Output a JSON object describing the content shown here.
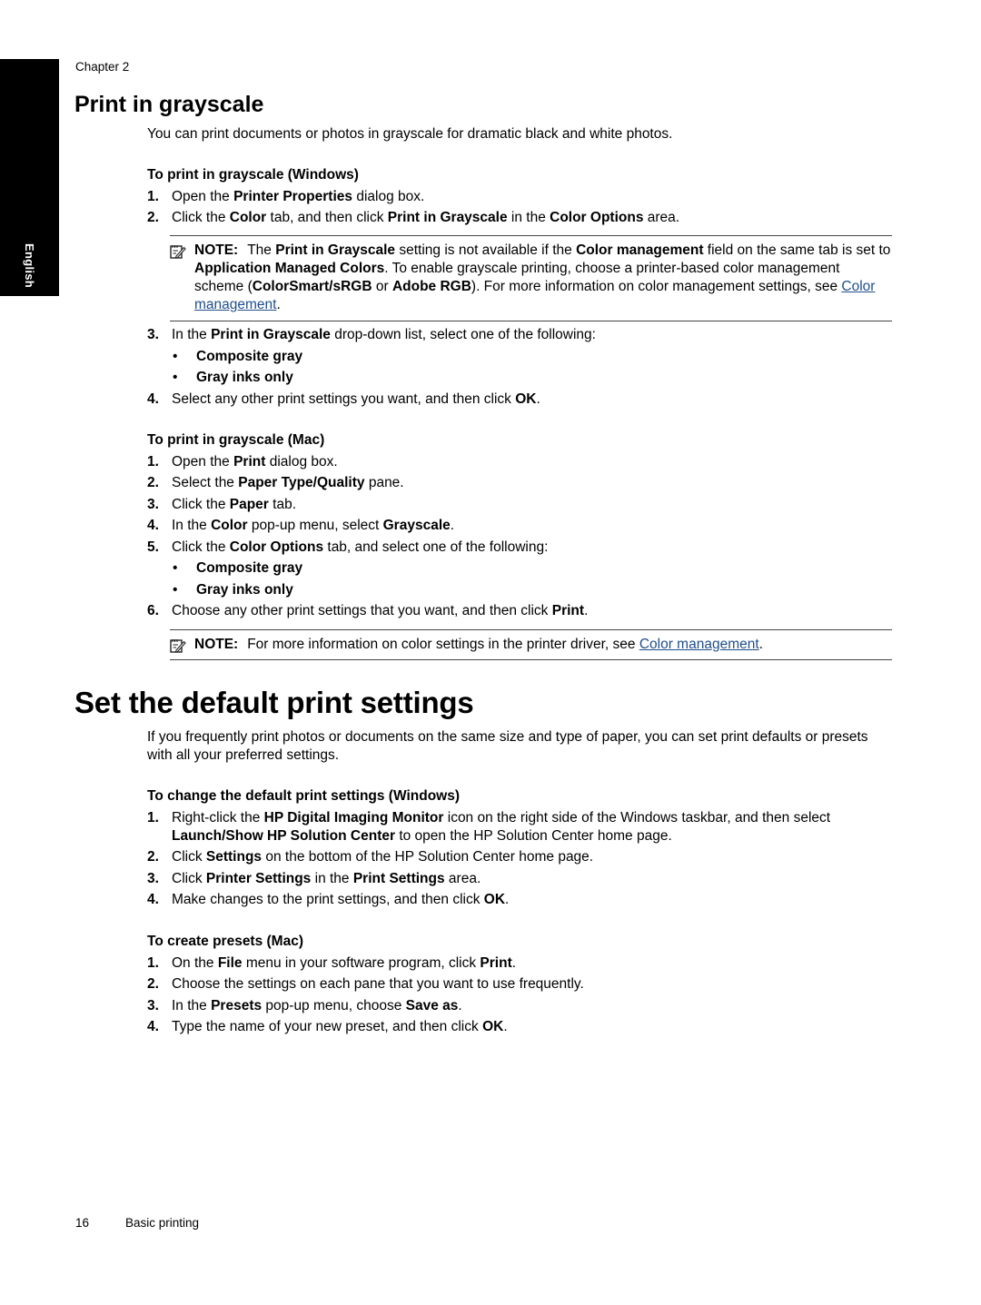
{
  "side_tab": {
    "label": "English"
  },
  "chapter": "Chapter 2",
  "colors": {
    "link": "#1f4e8c",
    "side_tab_bg": "#000000"
  },
  "section1": {
    "title": "Print in grayscale",
    "intro": "You can print documents or photos in grayscale for dramatic black and white photos.",
    "windows": {
      "heading": "To print in grayscale (Windows)",
      "steps_a": [
        {
          "num": "1.",
          "parts": [
            {
              "t": "Open the "
            },
            {
              "t": "Printer Properties",
              "b": true
            },
            {
              "t": " dialog box."
            }
          ]
        },
        {
          "num": "2.",
          "parts": [
            {
              "t": "Click the "
            },
            {
              "t": "Color",
              "b": true
            },
            {
              "t": " tab, and then click "
            },
            {
              "t": "Print in Grayscale",
              "b": true
            },
            {
              "t": " in the "
            },
            {
              "t": "Color Options",
              "b": true
            },
            {
              "t": " area."
            }
          ]
        }
      ],
      "note": {
        "label": "NOTE:",
        "icon": "note-pencil-icon",
        "parts": [
          {
            "t": "The "
          },
          {
            "t": "Print in Grayscale",
            "b": true
          },
          {
            "t": " setting is not available if the "
          },
          {
            "t": "Color management",
            "b": true
          },
          {
            "t": " field on the same tab is set to "
          },
          {
            "t": "Application Managed Colors",
            "b": true
          },
          {
            "t": ". To enable grayscale printing, choose a printer-based color management scheme ("
          },
          {
            "t": "ColorSmart/sRGB",
            "b": true
          },
          {
            "t": " or "
          },
          {
            "t": "Adobe RGB",
            "b": true
          },
          {
            "t": "). For more information on color management settings, see "
          },
          {
            "t": "Color management",
            "link": true
          },
          {
            "t": "."
          }
        ]
      },
      "step3": {
        "num": "3.",
        "parts": [
          {
            "t": "In the "
          },
          {
            "t": "Print in Grayscale",
            "b": true
          },
          {
            "t": " drop-down list, select one of the following:"
          }
        ]
      },
      "bullets": [
        "Composite gray",
        "Gray inks only"
      ],
      "step4": {
        "num": "4.",
        "parts": [
          {
            "t": "Select any other print settings you want, and then click "
          },
          {
            "t": "OK",
            "b": true
          },
          {
            "t": "."
          }
        ]
      }
    },
    "mac": {
      "heading": "To print in grayscale (Mac)",
      "steps_a": [
        {
          "num": "1.",
          "parts": [
            {
              "t": "Open the "
            },
            {
              "t": "Print",
              "b": true
            },
            {
              "t": " dialog box."
            }
          ]
        },
        {
          "num": "2.",
          "parts": [
            {
              "t": "Select the "
            },
            {
              "t": "Paper Type/Quality",
              "b": true
            },
            {
              "t": " pane."
            }
          ]
        },
        {
          "num": "3.",
          "parts": [
            {
              "t": "Click the "
            },
            {
              "t": "Paper",
              "b": true
            },
            {
              "t": " tab."
            }
          ]
        },
        {
          "num": "4.",
          "parts": [
            {
              "t": "In the "
            },
            {
              "t": "Color",
              "b": true
            },
            {
              "t": " pop-up menu, select "
            },
            {
              "t": "Grayscale",
              "b": true
            },
            {
              "t": "."
            }
          ]
        },
        {
          "num": "5.",
          "parts": [
            {
              "t": "Click the "
            },
            {
              "t": "Color Options",
              "b": true
            },
            {
              "t": " tab, and select one of the following:"
            }
          ]
        }
      ],
      "bullets": [
        "Composite gray",
        "Gray inks only"
      ],
      "step6": {
        "num": "6.",
        "parts": [
          {
            "t": "Choose any other print settings that you want, and then click "
          },
          {
            "t": "Print",
            "b": true
          },
          {
            "t": "."
          }
        ]
      },
      "note": {
        "label": "NOTE:",
        "icon": "note-pencil-icon",
        "parts": [
          {
            "t": "For more information on color settings in the printer driver, see "
          },
          {
            "t": "Color management",
            "link": true
          },
          {
            "t": "."
          }
        ]
      }
    }
  },
  "section2": {
    "title": "Set the default print settings",
    "intro": "If you frequently print photos or documents on the same size and type of paper, you can set print defaults or presets with all your preferred settings.",
    "windows": {
      "heading": "To change the default print settings (Windows)",
      "steps": [
        {
          "num": "1.",
          "parts": [
            {
              "t": "Right-click the "
            },
            {
              "t": "HP Digital Imaging Monitor",
              "b": true
            },
            {
              "t": " icon on the right side of the Windows taskbar, and then select "
            },
            {
              "t": "Launch/Show HP Solution Center",
              "b": true
            },
            {
              "t": " to open the HP Solution Center home page."
            }
          ]
        },
        {
          "num": "2.",
          "parts": [
            {
              "t": "Click "
            },
            {
              "t": "Settings",
              "b": true
            },
            {
              "t": " on the bottom of the HP Solution Center home page."
            }
          ]
        },
        {
          "num": "3.",
          "parts": [
            {
              "t": "Click "
            },
            {
              "t": "Printer Settings",
              "b": true
            },
            {
              "t": " in the "
            },
            {
              "t": "Print Settings",
              "b": true
            },
            {
              "t": " area."
            }
          ]
        },
        {
          "num": "4.",
          "parts": [
            {
              "t": "Make changes to the print settings, and then click "
            },
            {
              "t": "OK",
              "b": true
            },
            {
              "t": "."
            }
          ]
        }
      ]
    },
    "mac": {
      "heading": "To create presets (Mac)",
      "steps": [
        {
          "num": "1.",
          "parts": [
            {
              "t": "On the "
            },
            {
              "t": "File",
              "b": true
            },
            {
              "t": " menu in your software program, click "
            },
            {
              "t": "Print",
              "b": true
            },
            {
              "t": "."
            }
          ]
        },
        {
          "num": "2.",
          "parts": [
            {
              "t": "Choose the settings on each pane that you want to use frequently."
            }
          ]
        },
        {
          "num": "3.",
          "parts": [
            {
              "t": "In the "
            },
            {
              "t": "Presets",
              "b": true
            },
            {
              "t": " pop-up menu, choose "
            },
            {
              "t": "Save as",
              "b": true
            },
            {
              "t": "."
            }
          ]
        },
        {
          "num": "4.",
          "parts": [
            {
              "t": "Type the name of your new preset, and then click "
            },
            {
              "t": "OK",
              "b": true
            },
            {
              "t": "."
            }
          ]
        }
      ]
    }
  },
  "footer": {
    "page_number": "16",
    "section": "Basic printing"
  }
}
